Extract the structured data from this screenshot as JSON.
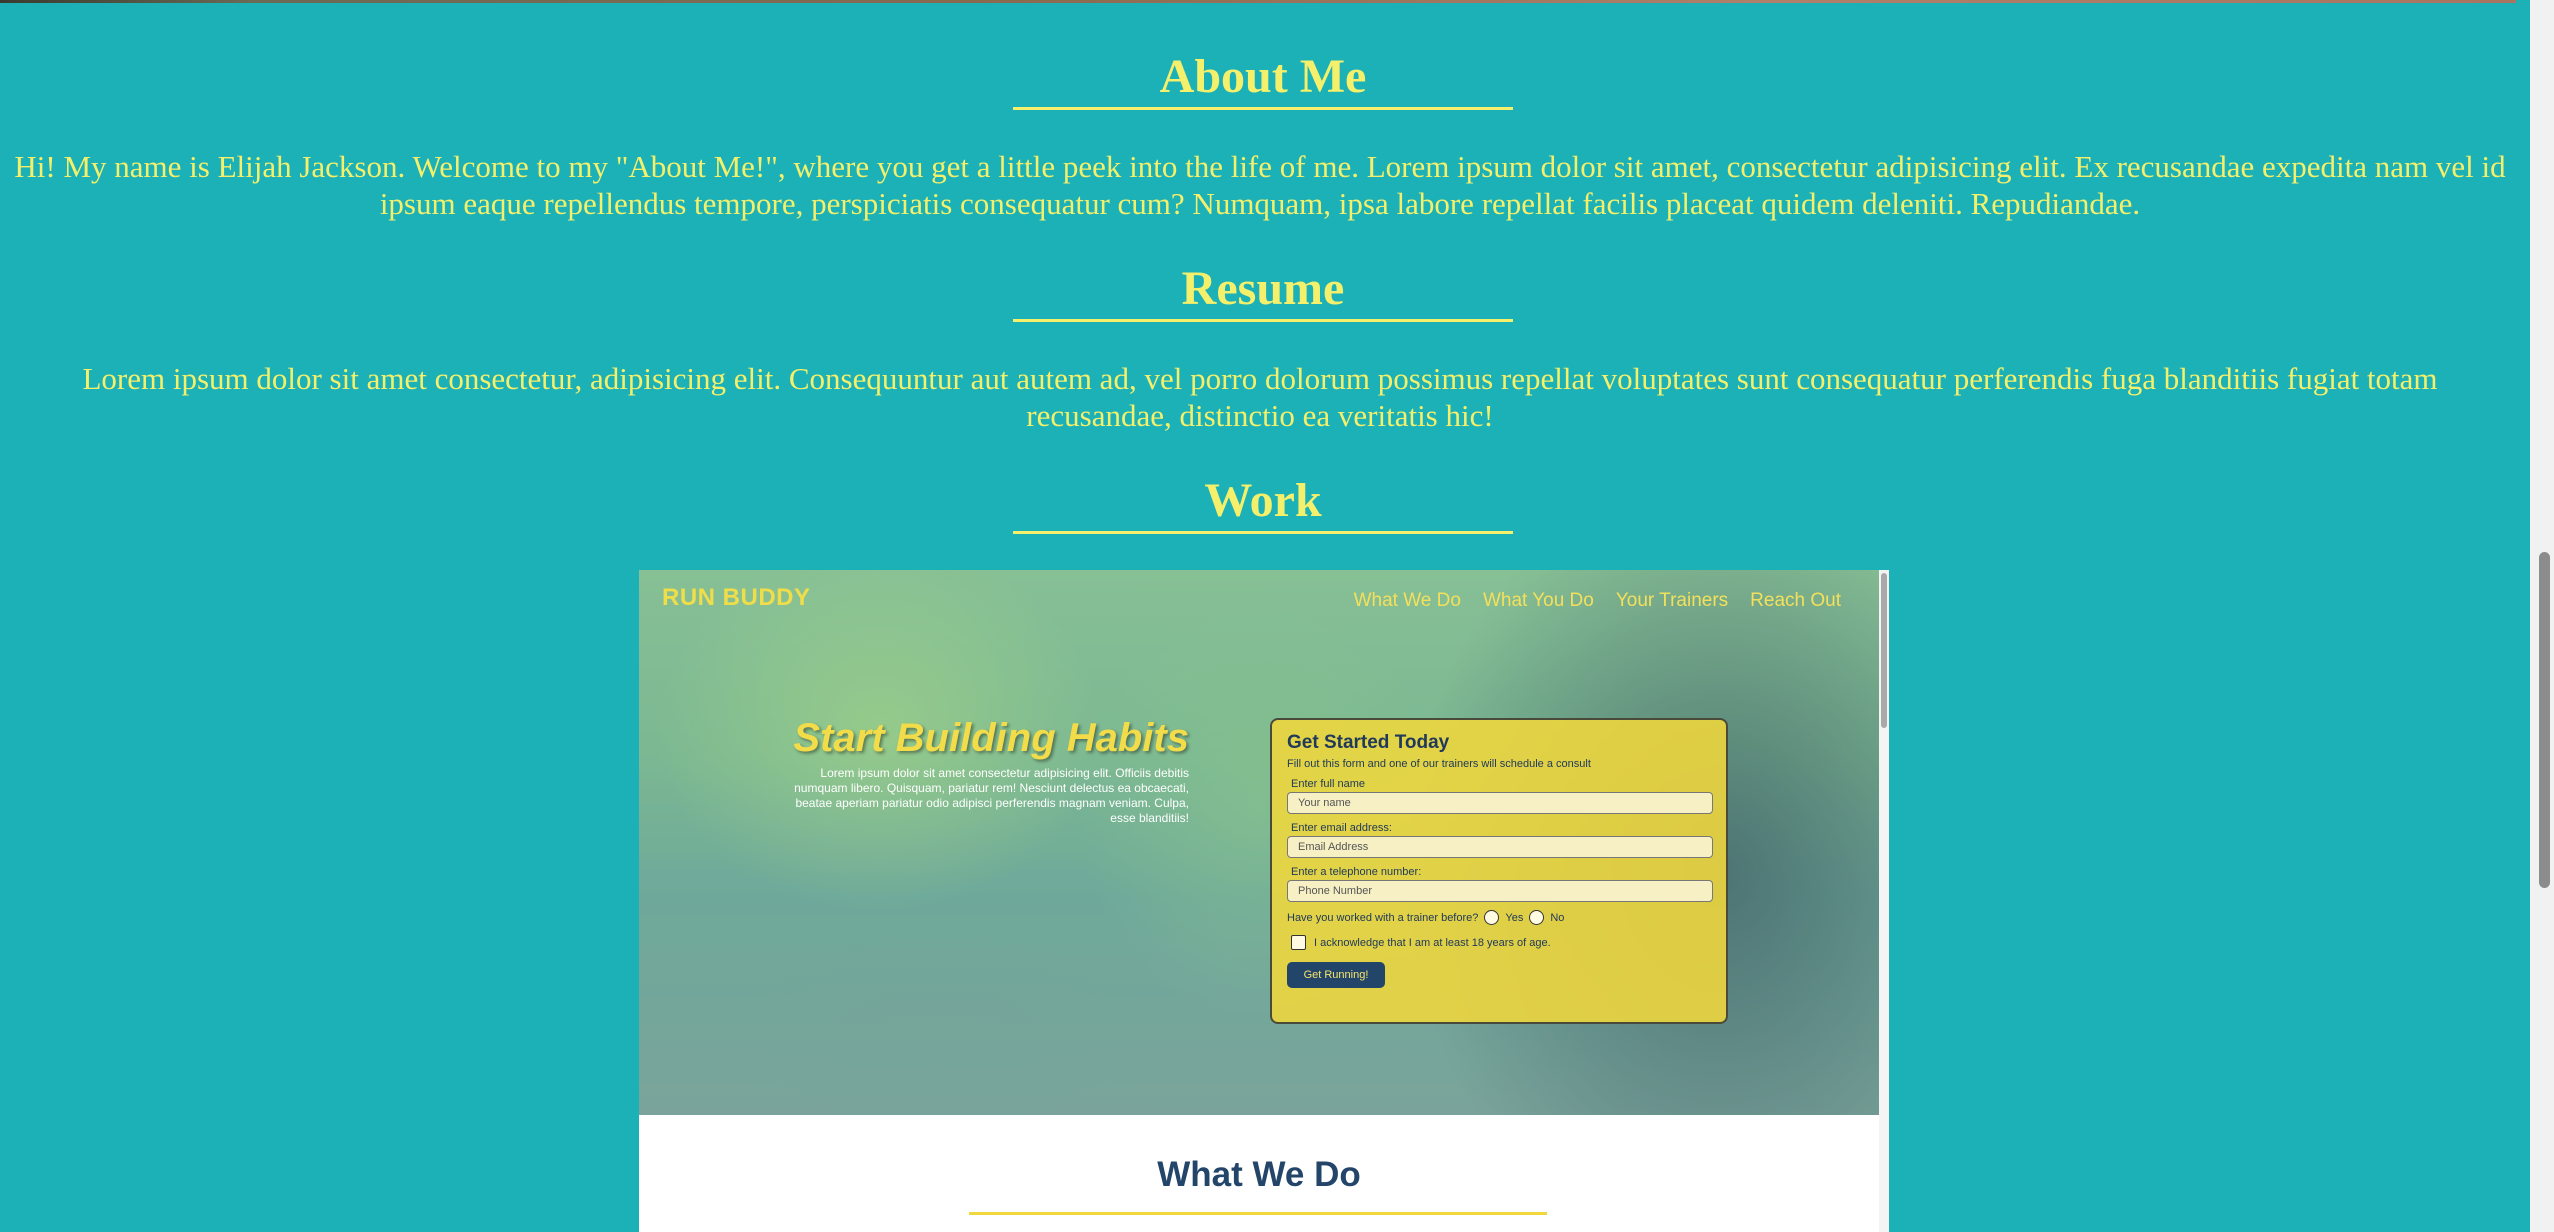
{
  "about": {
    "heading": "About Me",
    "text": "Hi! My name is Elijah Jackson. Welcome to my \"About Me!\", where you get a little peek into the life of me. Lorem ipsum dolor sit amet, consectetur adipisicing elit. Ex recusandae expedita nam vel id ipsum eaque repellendus tempore, perspiciatis consequatur cum? Numquam, ipsa labore repellat facilis placeat quidem deleniti. Repudiandae."
  },
  "resume": {
    "heading": "Resume",
    "text": "Lorem ipsum dolor sit amet consectetur, adipisicing elit. Consequuntur aut autem ad, vel porro dolorum possimus repellat voluptates sunt consequatur perferendis fuga blanditiis fugiat totam recusandae, distinctio ea veritatis hic!"
  },
  "work": {
    "heading": "Work",
    "project": {
      "brand": "RUN BUDDY",
      "nav": [
        "What We Do",
        "What You Do",
        "Your Trainers",
        "Reach Out"
      ],
      "hero_title": "Start Building Habits",
      "hero_text": "Lorem ipsum dolor sit amet consectetur adipisicing elit. Officiis debitis numquam libero. Quisquam, pariatur rem! Nesciunt delectus ea obcaecati, beatae aperiam pariatur odio adipisci perferendis magnam veniam. Culpa, esse blanditiis!",
      "form": {
        "title": "Get Started Today",
        "subtitle": "Fill out this form and one of our trainers will schedule a consult",
        "name_label": "Enter full name",
        "name_placeholder": "Your name",
        "email_label": "Enter email address:",
        "email_placeholder": "Email Address",
        "phone_label": "Enter a telephone number:",
        "phone_placeholder": "Phone Number",
        "trainer_question": "Have you worked with a trainer before?",
        "yes_label": "Yes",
        "no_label": "No",
        "ack_label": "I acknowledge that I am at least 18 years of age.",
        "submit_label": "Get Running!"
      },
      "next_section_title": "What We Do"
    }
  },
  "colors": {
    "background": "#1cb0b7",
    "accent_yellow": "#f4f06b",
    "project_navy": "#24456a",
    "project_yellow": "#f0d73c"
  }
}
